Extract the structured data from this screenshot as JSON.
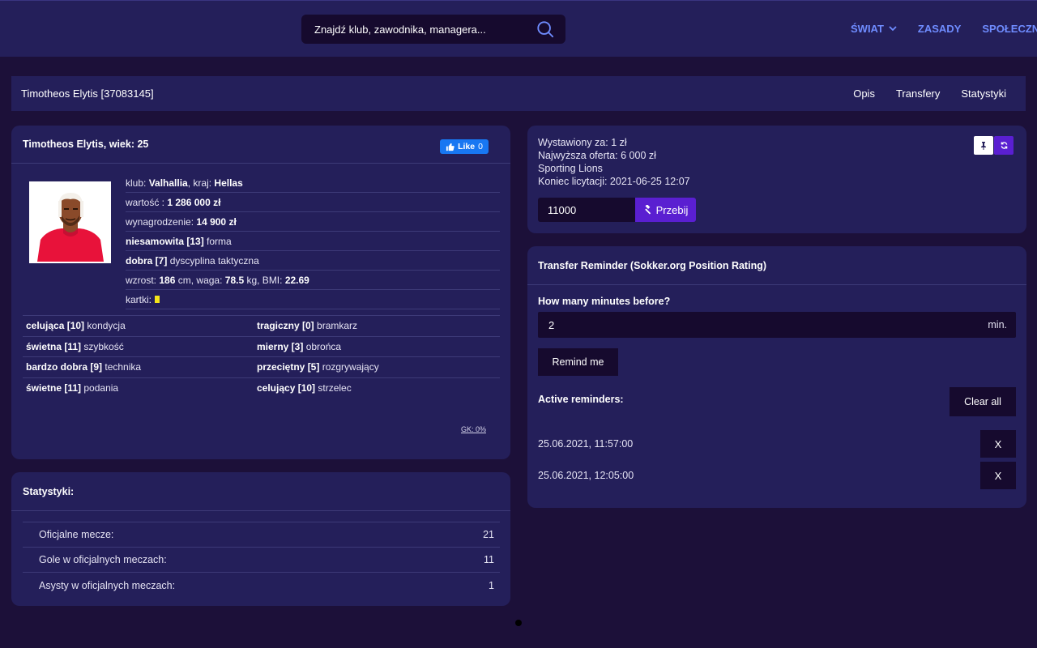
{
  "header": {
    "search_placeholder": "Znajdź klub, zawodnika, managera...",
    "nav": [
      {
        "label": "ŚWIAT"
      },
      {
        "label": "ZASADY"
      },
      {
        "label": "SPOŁECZNOŚĆ"
      }
    ],
    "accent_color": "#6f8cff"
  },
  "breadcrumb": {
    "title": "Timotheos Elytis [37083145]",
    "tabs": [
      "Opis",
      "Transfery",
      "Statystyki"
    ]
  },
  "player": {
    "heading": "Timotheos Elytis, wiek: 25",
    "fb_like": "Like",
    "fb_count": "0",
    "club_label": "klub:",
    "club": "Valhallia",
    "country_label": ", kraj:",
    "country": "Hellas",
    "value_label": "wartość :",
    "value": "1 286 000 zł",
    "salary_label": "wynagrodzenie:",
    "salary": "14 900 zł",
    "form_level": "niesamowita [13]",
    "form_label": "forma",
    "discipline_level": "dobra [7]",
    "discipline_label": "dyscyplina taktyczna",
    "height_label": "wzrost:",
    "height": "186",
    "height_unit": "cm, waga:",
    "weight": "78.5",
    "weight_unit": "kg, BMI:",
    "bmi": "22.69",
    "cards_label": "kartki:",
    "skills": [
      [
        {
          "level": "celująca [10]",
          "name": "kondycja"
        },
        {
          "level": "tragiczny [0]",
          "name": "bramkarz"
        }
      ],
      [
        {
          "level": "świetna [11]",
          "name": "szybkość"
        },
        {
          "level": "mierny [3]",
          "name": "obrońca"
        }
      ],
      [
        {
          "level": "bardzo dobra [9]",
          "name": "technika"
        },
        {
          "level": "przeciętny [5]",
          "name": "rozgrywający"
        }
      ],
      [
        {
          "level": "świetne [11]",
          "name": "podania"
        },
        {
          "level": "celujący [10]",
          "name": "strzelec"
        }
      ]
    ],
    "gk": "GK: 0%"
  },
  "stats": {
    "heading": "Statystyki:",
    "rows": [
      {
        "label": "Oficjalne mecze:",
        "value": "21"
      },
      {
        "label": "Gole w oficjalnych meczach:",
        "value": "11"
      },
      {
        "label": "Asysty w oficjalnych meczach:",
        "value": "1"
      }
    ]
  },
  "auction": {
    "listed": "Wystawiony za: 1 zł",
    "highest": "Najwyższa oferta: 6 000 zł",
    "bidder": "Sporting Lions",
    "end": "Koniec licytacji: 2021-06-25 12:07",
    "bid_value": "11000",
    "bid_button": "Przebij"
  },
  "reminder": {
    "heading": "Transfer Reminder (Sokker.org Position Rating)",
    "question": "How many minutes before?",
    "minutes_value": "2",
    "unit": "min.",
    "remind_button": "Remind me",
    "active_label": "Active reminders:",
    "clear_button": "Clear all",
    "items": [
      {
        "time": "25.06.2021, 11:57:00",
        "remove": "X"
      },
      {
        "time": "25.06.2021, 12:05:00",
        "remove": "X"
      }
    ]
  }
}
